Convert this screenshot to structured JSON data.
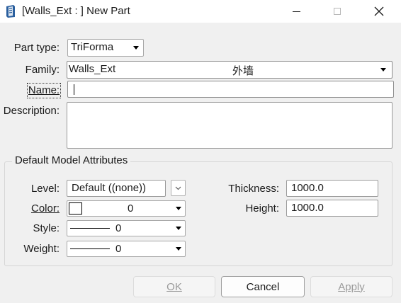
{
  "window": {
    "title": "[Walls_Ext : ] New Part",
    "minimize_glyph": "—",
    "maximize_glyph": "☐",
    "close_glyph": "✕"
  },
  "form": {
    "part_type_label": "Part type:",
    "part_type_value": "TriForma",
    "family_label": "Family:",
    "family_value": "Walls_Ext",
    "family_secondary": "外墙",
    "name_label": "Name:",
    "name_value": "",
    "description_label": "Description:",
    "description_value": ""
  },
  "group": {
    "title": "Default Model Attributes",
    "level_label": "Level:",
    "level_value": "Default ((none))",
    "color_label": "Color:",
    "color_value": "0",
    "style_label": "Style:",
    "style_value": "0",
    "weight_label": "Weight:",
    "weight_value": "0",
    "thickness_label": "Thickness:",
    "thickness_value": "1000.0",
    "height_label": "Height:",
    "height_value": "1000.0"
  },
  "buttons": {
    "ok": "OK",
    "cancel": "Cancel",
    "apply": "Apply"
  },
  "colors": {
    "background": "#f0f0f0",
    "disabled_text": "#9a9a9a"
  }
}
